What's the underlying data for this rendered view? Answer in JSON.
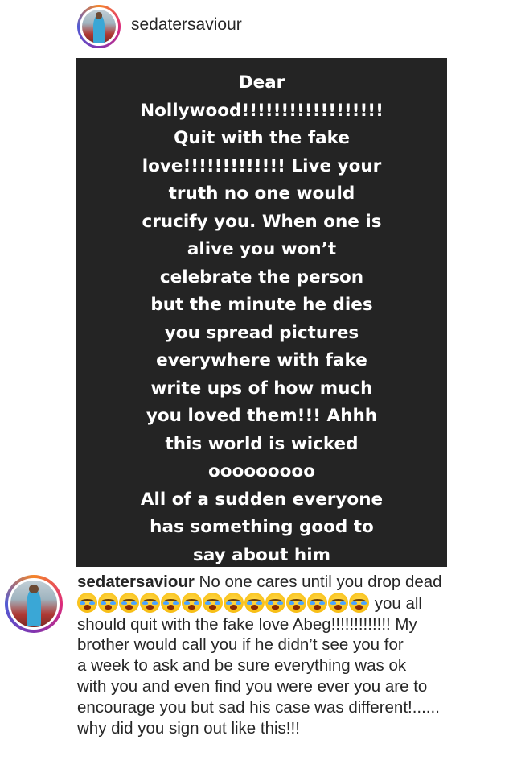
{
  "header": {
    "username": "sedatersaviour"
  },
  "story": {
    "lines": [
      "Dear",
      "Nollywood!!!!!!!!!!!!!!!!!!",
      "Quit with the fake",
      "love!!!!!!!!!!!!! Live your",
      "truth no one would",
      "crucify you. When one is",
      "alive you won’t",
      "celebrate the person",
      "but the minute he dies",
      "you spread pictures",
      "everywhere with fake",
      "write ups of how much",
      "you loved them!!! Ahhh",
      "this world is wicked",
      "ooooooooo",
      "All of a sudden everyone",
      "has something good to",
      "say about him"
    ]
  },
  "comment": {
    "username": "sedatersaviour",
    "line1_rest": " No one cares until you drop dead",
    "emoji_name": "loudly-crying-face-icon",
    "emoji_count": 14,
    "line2_rest": " you all",
    "lines": [
      "should quit with the fake love Abeg!!!!!!!!!!!!! My",
      "brother would call you if he didn’t see you for",
      "a week to ask and be sure everything was ok",
      "with you and even find you were ever you are to",
      "encourage you but sad his case was different!......",
      "why did you sign out like this!!!"
    ]
  }
}
